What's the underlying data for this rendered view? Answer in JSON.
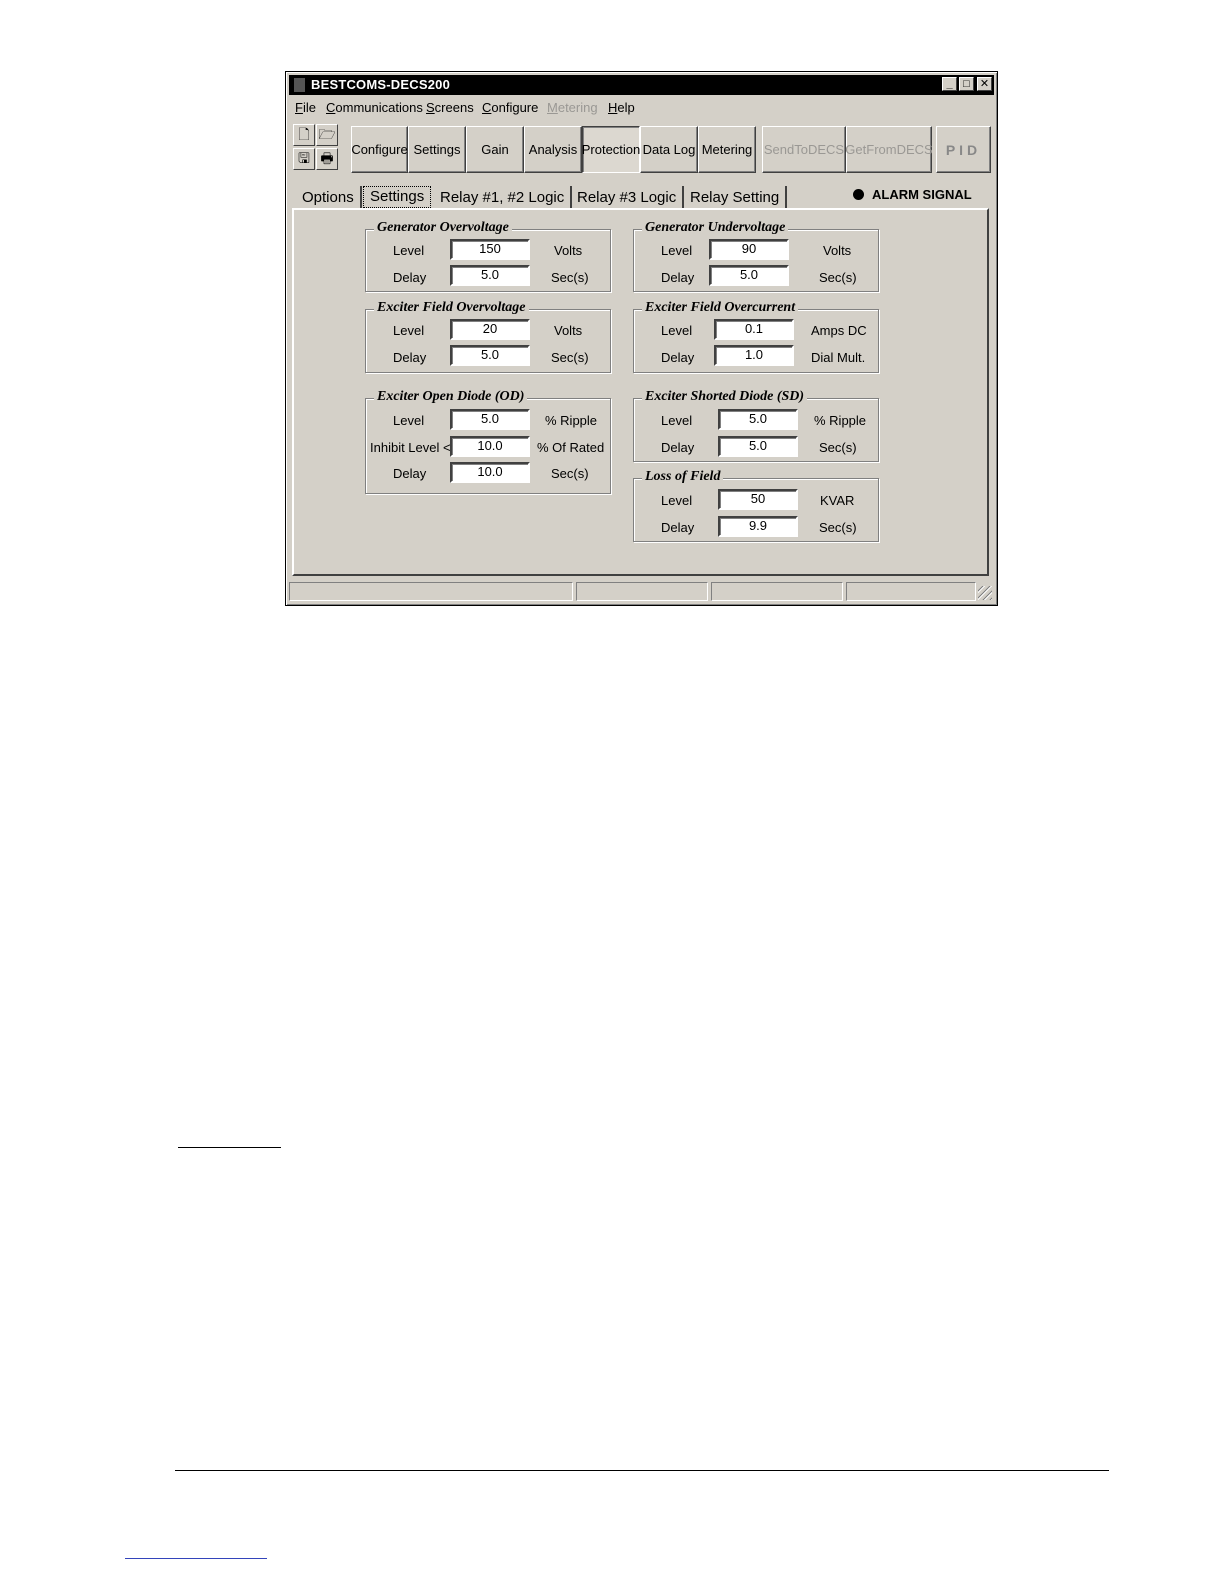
{
  "window": {
    "title": "BESTCOMS-DECS200",
    "controls": {
      "minimize": "_",
      "maximize": "□",
      "close": "✕"
    }
  },
  "menu": [
    {
      "label": "File",
      "underline": "F",
      "rest": "ile",
      "enabled": true
    },
    {
      "label": "Communications",
      "underline": "C",
      "rest": "ommunications",
      "enabled": true
    },
    {
      "label": "Screens",
      "underline": "S",
      "rest": "creens",
      "enabled": true
    },
    {
      "label": "Configure",
      "underline": "C",
      "rest": "onfigure",
      "enabled": true
    },
    {
      "label": "Metering",
      "underline": "M",
      "rest": "etering",
      "enabled": false
    },
    {
      "label": "Help",
      "underline": "H",
      "rest": "elp",
      "enabled": true
    }
  ],
  "toolbar": {
    "icons": [
      "new-file-icon",
      "open-folder-icon",
      "save-disk-icon",
      "print-icon"
    ],
    "buttons": {
      "configure": "Configure",
      "settings": "Settings",
      "gain": "Gain",
      "analysis": "Analysis",
      "protection": "Protection",
      "data_log": "Data Log",
      "metering": "Metering",
      "send": "SendToDECS",
      "get": "GetFromDECS",
      "pid": "PID"
    },
    "active": "Protection"
  },
  "tabs": {
    "options": "Options",
    "settings": "Settings",
    "relay12": "Relay #1, #2 Logic",
    "relay3": "Relay #3 Logic",
    "relay_setting": "Relay Setting",
    "active": "Settings"
  },
  "alarm": {
    "label": "ALARM SIGNAL"
  },
  "groups": {
    "gen_ov": {
      "title": "Generator Overvoltage",
      "level_label": "Level",
      "level_value": "150",
      "level_unit": "Volts",
      "delay_label": "Delay",
      "delay_value": "5.0",
      "delay_unit": "Sec(s)"
    },
    "gen_uv": {
      "title": "Generator Undervoltage",
      "level_label": "Level",
      "level_value": "90",
      "level_unit": "Volts",
      "delay_label": "Delay",
      "delay_value": "5.0",
      "delay_unit": "Sec(s)"
    },
    "exc_ov": {
      "title": "Exciter Field Overvoltage",
      "level_label": "Level",
      "level_value": "20",
      "level_unit": "Volts",
      "delay_label": "Delay",
      "delay_value": "5.0",
      "delay_unit": "Sec(s)"
    },
    "exc_oc": {
      "title": "Exciter Field Overcurrent",
      "level_label": "Level",
      "level_value": "0.1",
      "level_unit": "Amps DC",
      "delay_label": "Delay",
      "delay_value": "1.0",
      "delay_unit": "Dial Mult."
    },
    "exc_od": {
      "title": "Exciter Open Diode (OD)",
      "level_label": "Level",
      "level_value": "5.0",
      "level_unit": "% Ripple",
      "inhibit_label": "Inhibit Level <",
      "inhibit_value": "10.0",
      "inhibit_unit": "% Of Rated",
      "delay_label": "Delay",
      "delay_value": "10.0",
      "delay_unit": "Sec(s)"
    },
    "exc_sd": {
      "title": "Exciter Shorted Diode (SD)",
      "level_label": "Level",
      "level_value": "5.0",
      "level_unit": "% Ripple",
      "delay_label": "Delay",
      "delay_value": "5.0",
      "delay_unit": "Sec(s)"
    },
    "lof": {
      "title": "Loss of Field",
      "level_label": "Level",
      "level_value": "50",
      "level_unit": "KVAR",
      "delay_label": "Delay",
      "delay_value": "9.9",
      "delay_unit": "Sec(s)"
    }
  }
}
